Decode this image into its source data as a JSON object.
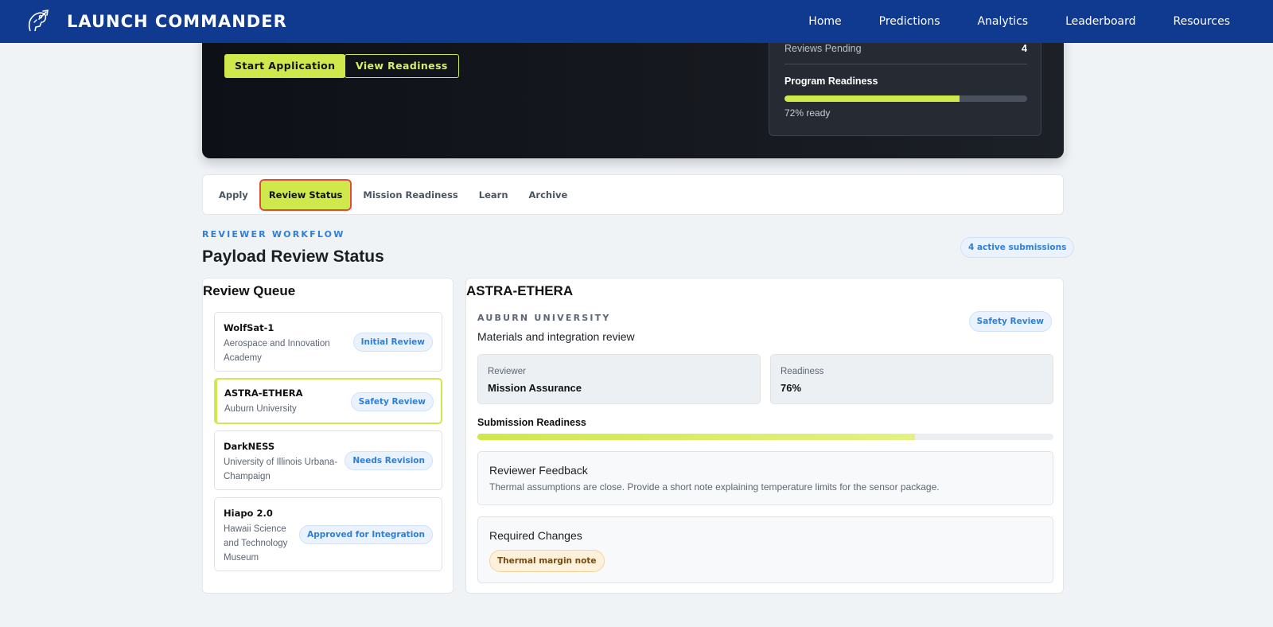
{
  "app": {
    "name": "LAUNCH COMMANDER",
    "logo_icon": "rocket-head-icon",
    "nav": [
      "Home",
      "Predictions",
      "Analytics",
      "Leaderboard",
      "Resources"
    ]
  },
  "hero": {
    "primary_button": "Start Application",
    "secondary_button": "View Readiness",
    "stats": {
      "reviews_pending_label": "Reviews Pending",
      "reviews_pending_value": "4",
      "program_readiness_label": "Program Readiness",
      "program_readiness_pct": 72,
      "program_readiness_note": "72% ready"
    }
  },
  "tabs": [
    "Apply",
    "Review Status",
    "Mission Readiness",
    "Learn",
    "Archive"
  ],
  "active_tab": "Review Status",
  "section": {
    "eyebrow": "REVIEWER WORKFLOW",
    "title": "Payload Review Status",
    "count_badge": "4 active submissions"
  },
  "queue": {
    "title": "Review Queue",
    "items": [
      {
        "name": "WolfSat-1",
        "org_lines": [
          "Aerospace and Innovation",
          "Academy"
        ],
        "status": "Initial Review"
      },
      {
        "name": "ASTRA-ETHERA",
        "org_lines": [
          "Auburn University"
        ],
        "status": "Safety Review",
        "selected": true
      },
      {
        "name": "DarkNESS",
        "org_lines": [
          "University of Illinois Urbana-",
          "Champaign"
        ],
        "status": "Needs Revision"
      },
      {
        "name": "Hiapo 2.0",
        "org_lines": [
          "Hawaii Science",
          "and Technology",
          "Museum"
        ],
        "status": "Approved for Integration"
      }
    ]
  },
  "detail": {
    "title": "ASTRA-ETHERA",
    "org": "AUBURN UNIVERSITY",
    "subtitle": "Materials and integration review",
    "status": "Safety Review",
    "reviewer_label": "Reviewer",
    "reviewer_value": "Mission Assurance",
    "readiness_label": "Readiness",
    "readiness_value": "76%",
    "submission_readiness_label": "Submission Readiness",
    "submission_readiness_pct": 76,
    "feedback_title": "Reviewer Feedback",
    "feedback_text": "Thermal assumptions are close. Provide a short note explaining temperature limits for the sensor package.",
    "changes_title": "Required Changes",
    "changes": [
      "Thermal margin note"
    ]
  }
}
